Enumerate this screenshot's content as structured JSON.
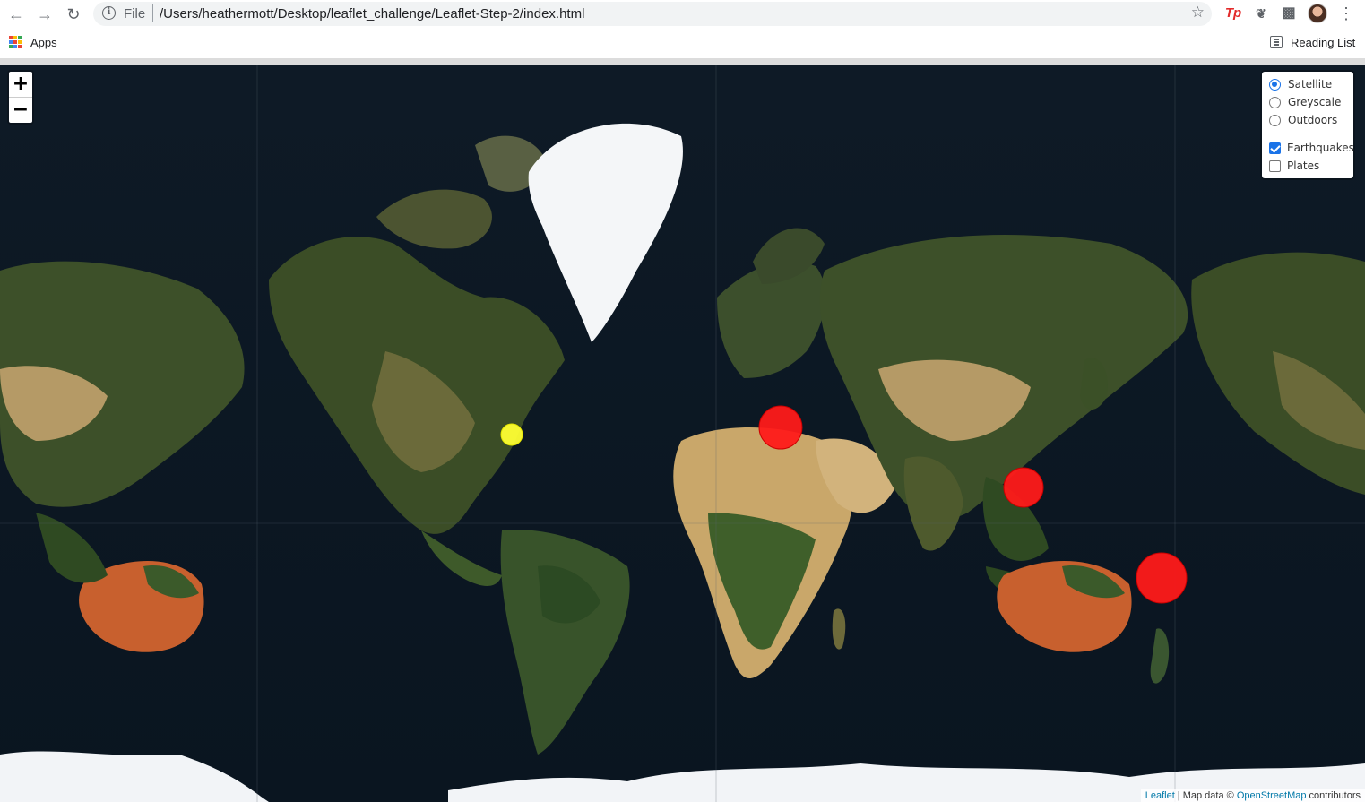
{
  "browser": {
    "back_icon": "arrow-left-icon",
    "forward_icon": "arrow-right-icon",
    "reload_icon": "reload-icon",
    "address": {
      "scheme_label": "File",
      "url": "/Users/heathermott/Desktop/leaflet_challenge/Leaflet-Step-2/index.html"
    },
    "extensions": [
      "Tp",
      "leaf-extension-icon",
      "puzzle-icon"
    ],
    "bookmarks": {
      "apps_label": "Apps",
      "reading_list_label": "Reading List"
    }
  },
  "map": {
    "zoom_in_label": "+",
    "zoom_out_label": "−",
    "base_layers": [
      {
        "label": "Satellite",
        "selected": true
      },
      {
        "label": "Greyscale",
        "selected": false
      },
      {
        "label": "Outdoors",
        "selected": false
      }
    ],
    "overlays": [
      {
        "label": "Earthquakes",
        "checked": true
      },
      {
        "label": "Plates",
        "checked": false
      }
    ],
    "attribution": {
      "leaflet_link": "Leaflet",
      "separator": " | Map data © ",
      "osm_link": "OpenStreetMap",
      "suffix": " contributors"
    },
    "marker_colors": {
      "low": "#ffff33",
      "high": "#ff1a1a"
    }
  }
}
